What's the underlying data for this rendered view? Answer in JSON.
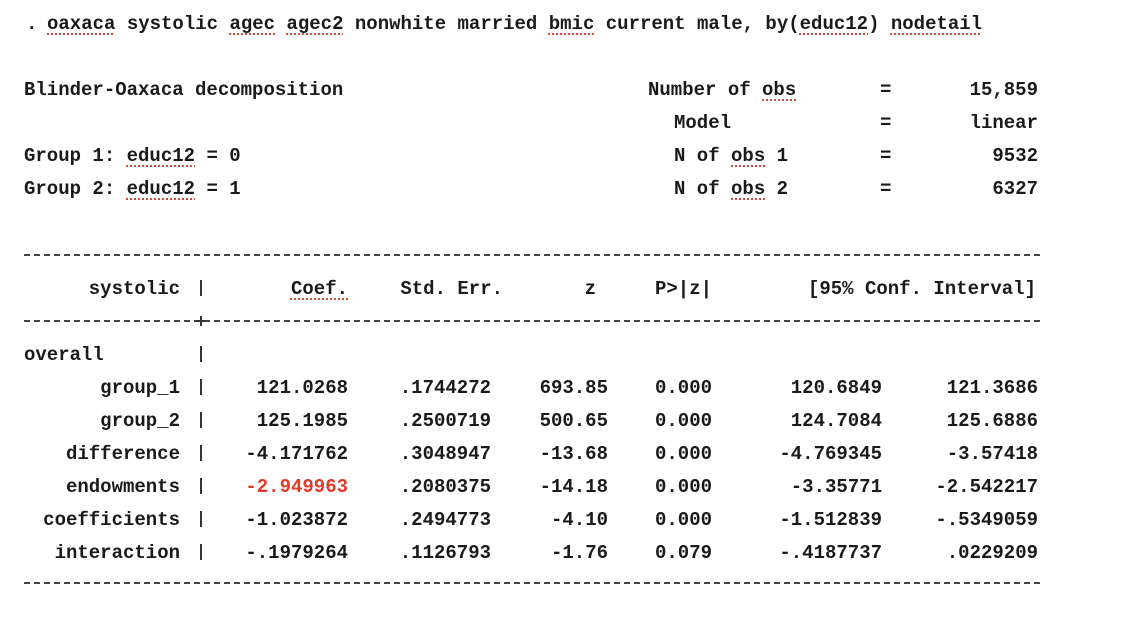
{
  "command": {
    "prompt": ".",
    "tokens": [
      {
        "text": "oaxaca",
        "flagged": true
      },
      {
        "text": "systolic",
        "flagged": false
      },
      {
        "text": "agec",
        "flagged": true
      },
      {
        "text": "agec2",
        "flagged": true
      },
      {
        "text": "nonwhite",
        "flagged": false
      },
      {
        "text": "married",
        "flagged": false
      },
      {
        "text": "bmic",
        "flagged": true
      },
      {
        "text": "current",
        "flagged": false
      },
      {
        "text": "male,",
        "flagged": false
      },
      {
        "text": "by(",
        "flagged": false
      },
      {
        "text": "educ12",
        "flagged": true
      },
      {
        "text": ")",
        "flagged": false
      },
      {
        "text": "nodetail",
        "flagged": true
      }
    ]
  },
  "header": {
    "title": "Blinder-Oaxaca decomposition",
    "group1": {
      "prefix": "Group 1: ",
      "var": "educ12",
      "suffix": " = 0"
    },
    "group2": {
      "prefix": "Group 2: ",
      "var": "educ12",
      "suffix": " = 1"
    },
    "stats": [
      {
        "label_parts": [
          {
            "text": "Number of ",
            "flagged": false
          },
          {
            "text": "obs",
            "flagged": true
          }
        ],
        "eq": "=",
        "value": "15,859"
      },
      {
        "label_parts": [
          {
            "text": "Model",
            "flagged": false
          }
        ],
        "eq": "=",
        "value": "linear"
      },
      {
        "label_parts": [
          {
            "text": "N of ",
            "flagged": false
          },
          {
            "text": "obs",
            "flagged": true
          },
          {
            "text": " 1",
            "flagged": false
          }
        ],
        "eq": "=",
        "value": "9532"
      },
      {
        "label_parts": [
          {
            "text": "N of ",
            "flagged": false
          },
          {
            "text": "obs",
            "flagged": true
          },
          {
            "text": " 2",
            "flagged": false
          }
        ],
        "eq": "=",
        "value": "6327"
      }
    ]
  },
  "table": {
    "depvar": "systolic",
    "columns": {
      "coef": "Coef.",
      "se": "Std. Err.",
      "z": "z",
      "p": "P>|z|",
      "ci": "[95% Conf. Interval]"
    },
    "section_label": "overall",
    "rows": [
      {
        "label": "group_1",
        "coef": "121.0268",
        "se": ".1744272",
        "z": "693.85",
        "p": "0.000",
        "lo": "120.6849",
        "hi": "121.3686",
        "highlight": false
      },
      {
        "label": "group_2",
        "coef": "125.1985",
        "se": ".2500719",
        "z": "500.65",
        "p": "0.000",
        "lo": "124.7084",
        "hi": "125.6886",
        "highlight": false
      },
      {
        "label": "difference",
        "coef": "-4.171762",
        "se": ".3048947",
        "z": "-13.68",
        "p": "0.000",
        "lo": "-4.769345",
        "hi": "-3.57418",
        "highlight": false
      },
      {
        "label": "endowments",
        "coef": "-2.949963",
        "se": ".2080375",
        "z": "-14.18",
        "p": "0.000",
        "lo": "-3.35771",
        "hi": "-2.542217",
        "highlight": true
      },
      {
        "label": "coefficients",
        "coef": "-1.023872",
        "se": ".2494773",
        "z": "-4.10",
        "p": "0.000",
        "lo": "-1.512839",
        "hi": "-.5349059",
        "highlight": false
      },
      {
        "label": "interaction",
        "coef": "-.1979264",
        "se": ".1126793",
        "z": "-1.76",
        "p": "0.079",
        "lo": "-.4187737",
        "hi": ".0229209",
        "highlight": false
      }
    ]
  },
  "colors": {
    "text": "#1a1a1a",
    "highlight": "#e03a2a",
    "squiggle": "#d64a3a"
  }
}
